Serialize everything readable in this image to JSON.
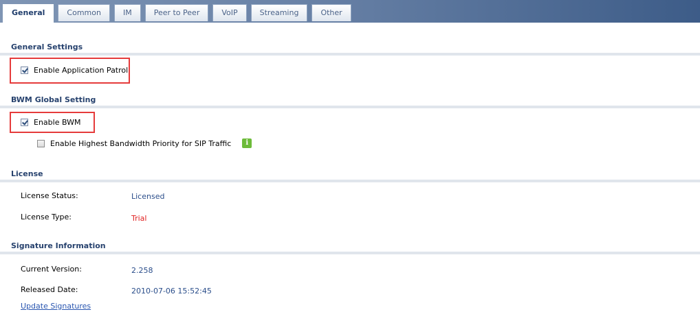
{
  "tabs": [
    {
      "label": "General",
      "active": true
    },
    {
      "label": "Common",
      "active": false
    },
    {
      "label": "IM",
      "active": false
    },
    {
      "label": "Peer to Peer",
      "active": false
    },
    {
      "label": "VoIP",
      "active": false
    },
    {
      "label": "Streaming",
      "active": false
    },
    {
      "label": "Other",
      "active": false
    }
  ],
  "general_settings": {
    "title": "General Settings",
    "enable_app_patrol": {
      "label": "Enable Application Patrol",
      "checked": true
    }
  },
  "bwm": {
    "title": "BWM Global Setting",
    "enable_bwm": {
      "label": "Enable BWM",
      "checked": true
    },
    "sip_priority": {
      "label": "Enable Highest Bandwidth Priority for SIP Traffic",
      "checked": false
    },
    "info_icon": "info-icon"
  },
  "license": {
    "title": "License",
    "status_label": "License Status:",
    "status_value": "Licensed",
    "type_label": "License Type:",
    "type_value": "Trial"
  },
  "signature": {
    "title": "Signature Information",
    "version_label": "Current Version:",
    "version_value": "2.258",
    "date_label": "Released Date:",
    "date_value": "2010-07-06 15:52:45",
    "update_link": "Update Signatures"
  },
  "colors": {
    "section_title": "#27426e",
    "highlight": "#e53a3a",
    "value_blue": "#2a4d8a",
    "value_red": "#e02020"
  }
}
